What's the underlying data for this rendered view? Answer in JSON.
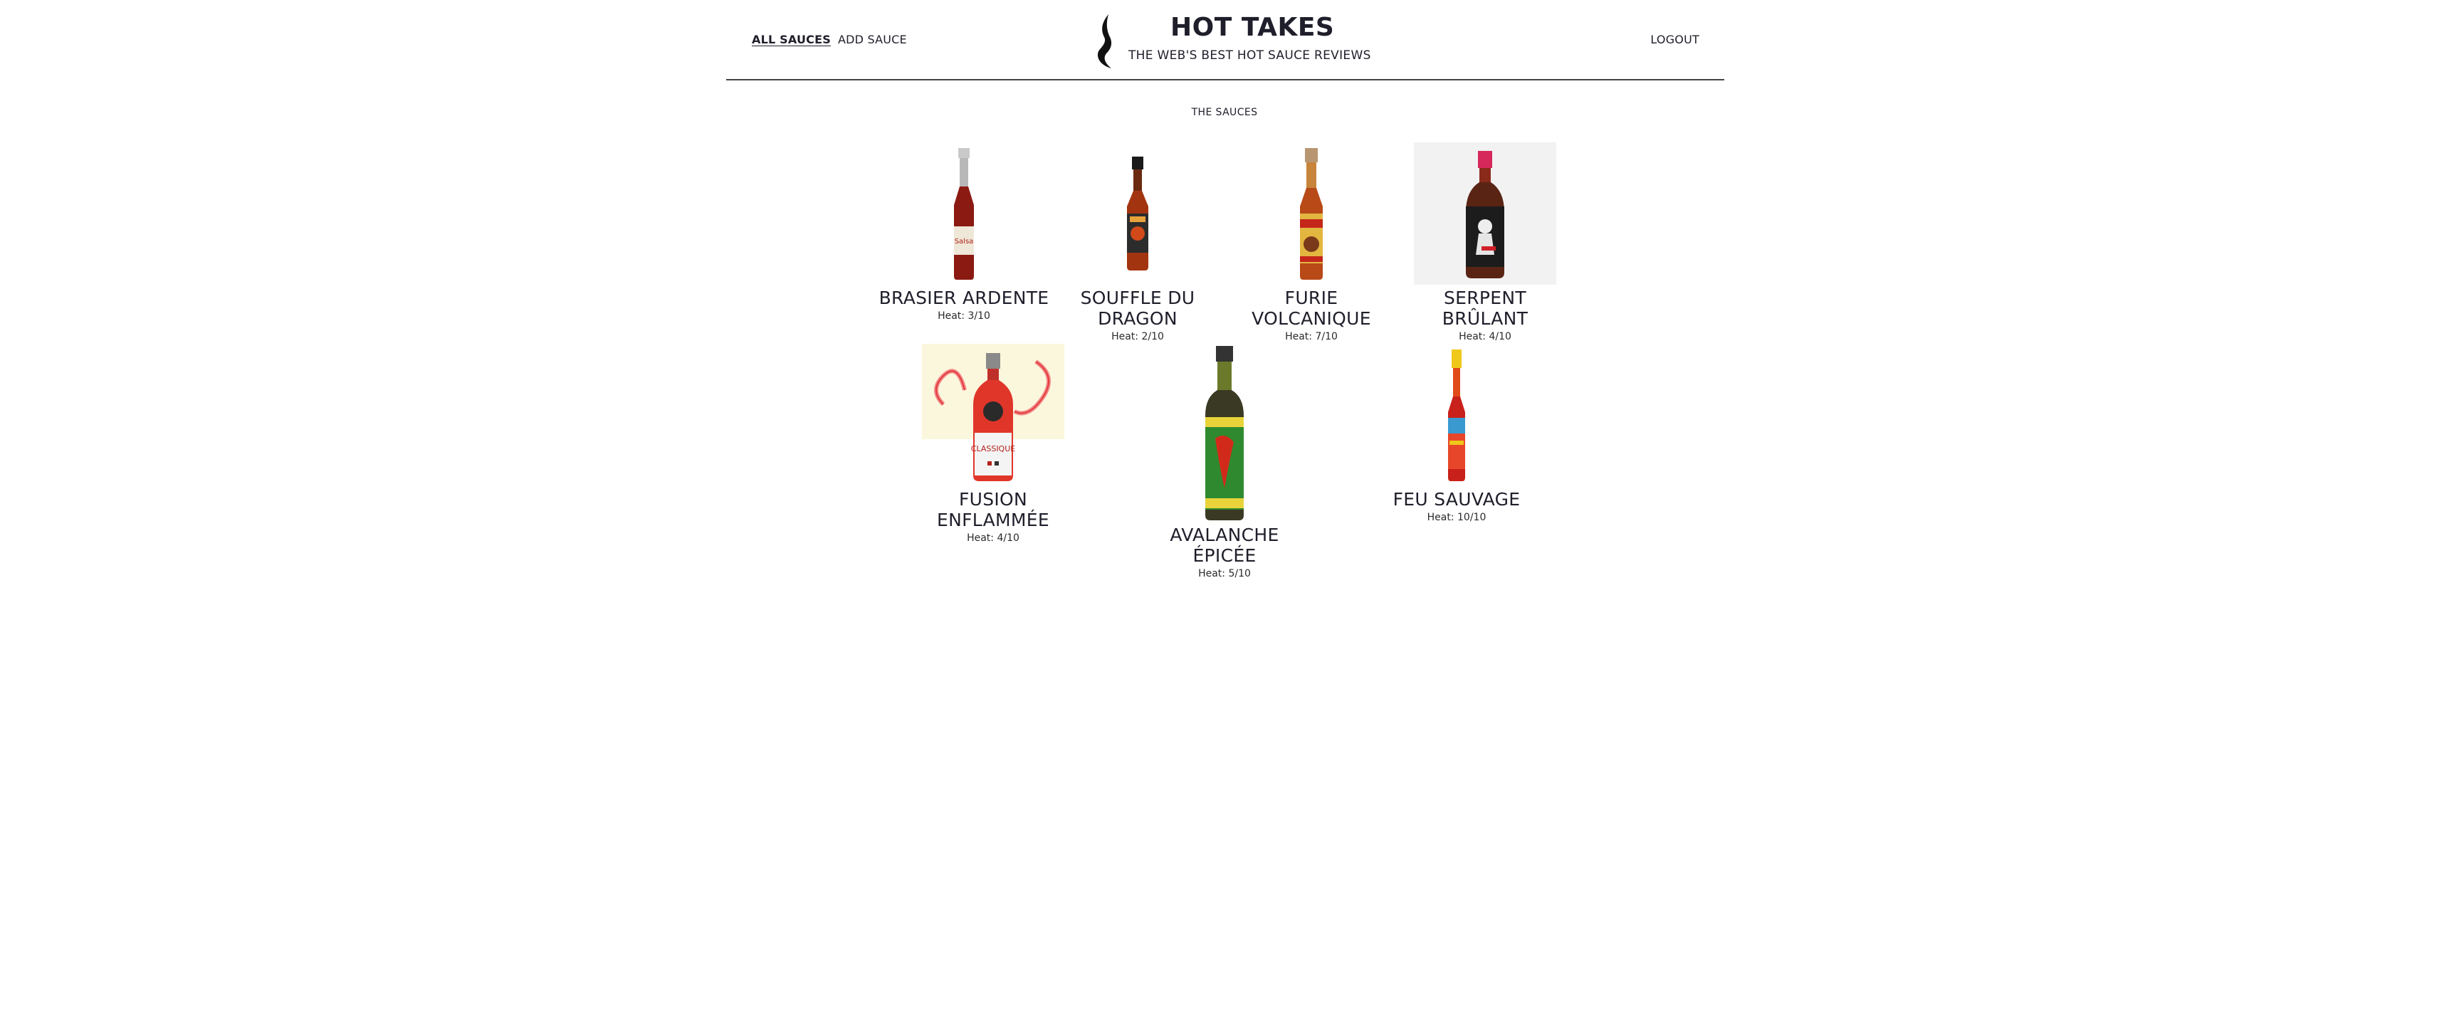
{
  "nav": {
    "all_sauces": "ALL SAUCES",
    "add_sauce": "ADD SAUCE",
    "logout": "LOGOUT"
  },
  "brand": {
    "title": "HOT TAKES",
    "tagline": "THE WEB'S BEST HOT SAUCE REVIEWS",
    "logo_icon": "flame-icon"
  },
  "main": {
    "section_title": "THE SAUCES"
  },
  "sauces": [
    {
      "name": "BRASIER ARDENTE",
      "heat": "Heat: 3/10"
    },
    {
      "name": "SOUFFLE DU DRAGON",
      "heat": "Heat: 2/10"
    },
    {
      "name": "FURIE VOLCANIQUE",
      "heat": "Heat: 7/10"
    },
    {
      "name": "SERPENT BRÛLANT",
      "heat": "Heat: 4/10"
    },
    {
      "name": "FUSION ENFLAMMÉE",
      "heat": "Heat: 4/10"
    },
    {
      "name": "AVALANCHE ÉPICÉE",
      "heat": "Heat: 5/10"
    },
    {
      "name": "FEU SAUVAGE",
      "heat": "Heat: 10/10"
    }
  ],
  "colors": {
    "text": "#1f1f2b",
    "divider": "#444444",
    "image_bg_grey": "#f2f2f2",
    "image_bg_cream": "#fbf7dd"
  }
}
